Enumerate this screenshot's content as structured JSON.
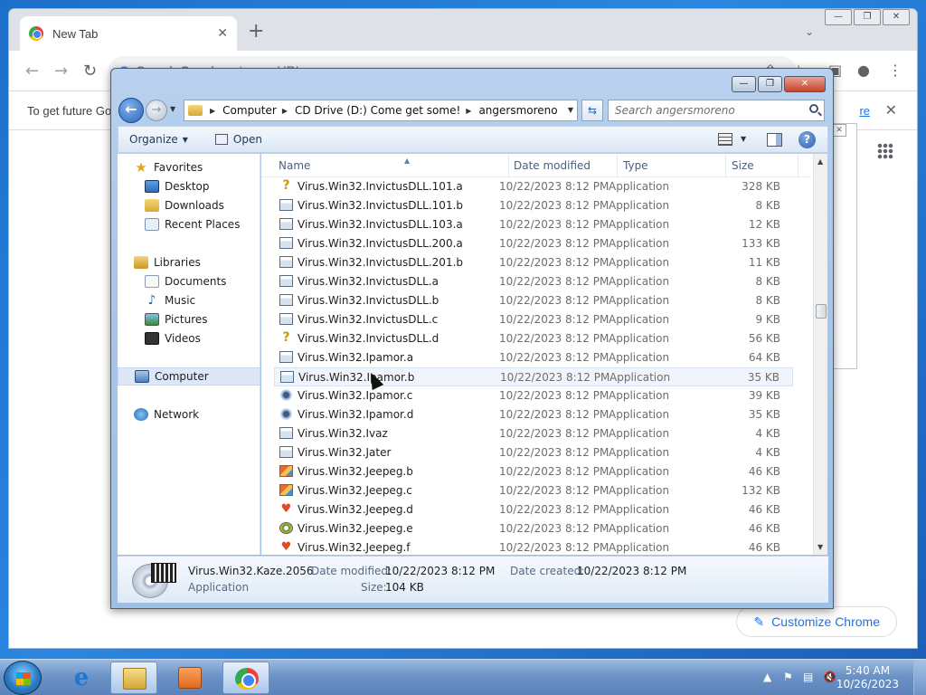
{
  "chrome": {
    "tab_title": "New Tab",
    "tab_close": "✕",
    "new_tab": "+",
    "omnibox_placeholder": "Search Google or type a URL",
    "infobar_text": "To get future Go",
    "infobar_link": "re",
    "infobar_close": "✕",
    "customize_label": "Customize Chrome",
    "nav_back": "←",
    "nav_forward": "→",
    "reload": "↻"
  },
  "explorer": {
    "breadcrumbs": [
      "Computer",
      "CD Drive (D:) Come get some!",
      "angersmoreno"
    ],
    "search_placeholder": "Search angersmoreno",
    "toolbar": {
      "organize": "Organize",
      "open": "Open"
    },
    "nav": {
      "favorites": "Favorites",
      "desktop": "Desktop",
      "downloads": "Downloads",
      "recent": "Recent Places",
      "libraries": "Libraries",
      "documents": "Documents",
      "music": "Music",
      "pictures": "Pictures",
      "videos": "Videos",
      "computer": "Computer",
      "network": "Network"
    },
    "columns": {
      "name": "Name",
      "date": "Date modified",
      "type": "Type",
      "size": "Size"
    },
    "files": [
      {
        "name": "Virus.Win32.InvictusDLL.101.a",
        "date": "10/22/2023 8:12 PM",
        "type": "Application",
        "size": "328 KB",
        "icon": "q"
      },
      {
        "name": "Virus.Win32.InvictusDLL.101.b",
        "date": "10/22/2023 8:12 PM",
        "type": "Application",
        "size": "8 KB",
        "icon": "app"
      },
      {
        "name": "Virus.Win32.InvictusDLL.103.a",
        "date": "10/22/2023 8:12 PM",
        "type": "Application",
        "size": "12 KB",
        "icon": "app"
      },
      {
        "name": "Virus.Win32.InvictusDLL.200.a",
        "date": "10/22/2023 8:12 PM",
        "type": "Application",
        "size": "133 KB",
        "icon": "app"
      },
      {
        "name": "Virus.Win32.InvictusDLL.201.b",
        "date": "10/22/2023 8:12 PM",
        "type": "Application",
        "size": "11 KB",
        "icon": "app"
      },
      {
        "name": "Virus.Win32.InvictusDLL.a",
        "date": "10/22/2023 8:12 PM",
        "type": "Application",
        "size": "8 KB",
        "icon": "app"
      },
      {
        "name": "Virus.Win32.InvictusDLL.b",
        "date": "10/22/2023 8:12 PM",
        "type": "Application",
        "size": "8 KB",
        "icon": "app"
      },
      {
        "name": "Virus.Win32.InvictusDLL.c",
        "date": "10/22/2023 8:12 PM",
        "type": "Application",
        "size": "9 KB",
        "icon": "app"
      },
      {
        "name": "Virus.Win32.InvictusDLL.d",
        "date": "10/22/2023 8:12 PM",
        "type": "Application",
        "size": "56 KB",
        "icon": "q"
      },
      {
        "name": "Virus.Win32.Ipamor.a",
        "date": "10/22/2023 8:12 PM",
        "type": "Application",
        "size": "64 KB",
        "icon": "app"
      },
      {
        "name": "Virus.Win32.Ipamor.b",
        "date": "10/22/2023 8:12 PM",
        "type": "Application",
        "size": "35 KB",
        "icon": "app"
      },
      {
        "name": "Virus.Win32.Ipamor.c",
        "date": "10/22/2023 8:12 PM",
        "type": "Application",
        "size": "39 KB",
        "icon": "gear"
      },
      {
        "name": "Virus.Win32.Ipamor.d",
        "date": "10/22/2023 8:12 PM",
        "type": "Application",
        "size": "35 KB",
        "icon": "gear"
      },
      {
        "name": "Virus.Win32.Ivaz",
        "date": "10/22/2023 8:12 PM",
        "type": "Application",
        "size": "4 KB",
        "icon": "app"
      },
      {
        "name": "Virus.Win32.Jater",
        "date": "10/22/2023 8:12 PM",
        "type": "Application",
        "size": "4 KB",
        "icon": "app"
      },
      {
        "name": "Virus.Win32.Jeepeg.b",
        "date": "10/22/2023 8:12 PM",
        "type": "Application",
        "size": "46 KB",
        "icon": "pic"
      },
      {
        "name": "Virus.Win32.Jeepeg.c",
        "date": "10/22/2023 8:12 PM",
        "type": "Application",
        "size": "132 KB",
        "icon": "pic"
      },
      {
        "name": "Virus.Win32.Jeepeg.d",
        "date": "10/22/2023 8:12 PM",
        "type": "Application",
        "size": "46 KB",
        "icon": "heart"
      },
      {
        "name": "Virus.Win32.Jeepeg.e",
        "date": "10/22/2023 8:12 PM",
        "type": "Application",
        "size": "46 KB",
        "icon": "disc"
      },
      {
        "name": "Virus.Win32.Jeepeg.f",
        "date": "10/22/2023 8:12 PM",
        "type": "Application",
        "size": "46 KB",
        "icon": "heart"
      }
    ],
    "details": {
      "name": "Virus.Win32.Kaze.2056",
      "type": "Application",
      "date_modified_label": "Date modified:",
      "date_modified": "10/22/2023 8:12 PM",
      "date_created_label": "Date created:",
      "date_created": "10/22/2023 8:12 PM",
      "size_label": "Size:",
      "size": "104 KB"
    }
  },
  "taskbar": {
    "time": "5:40 AM",
    "date": "10/26/2023"
  }
}
